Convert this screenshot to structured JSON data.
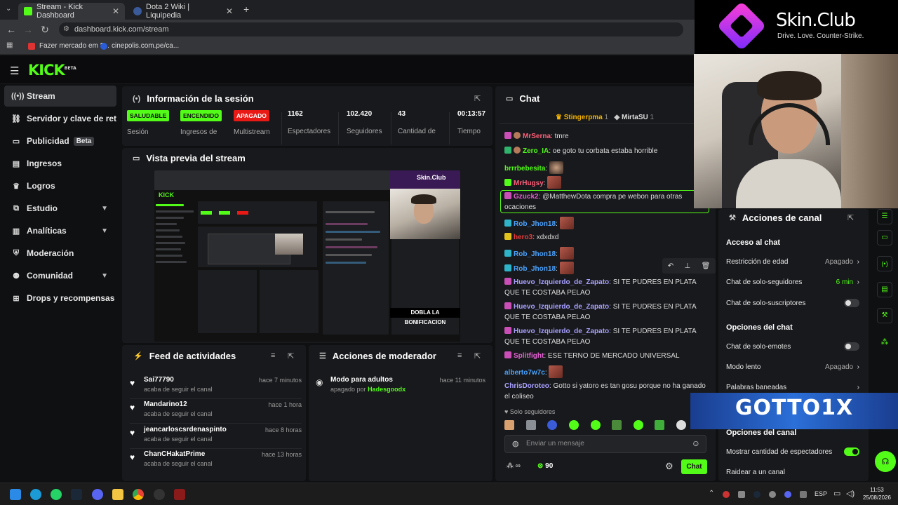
{
  "browser": {
    "tabs": [
      {
        "title": "Stream - Kick Dashboard",
        "active": true
      },
      {
        "title": "Dota 2 Wiki | Liquipedia",
        "active": false
      }
    ],
    "url": "dashboard.kick.com/stream",
    "bookmarks": [
      "Fazer mercado em F...",
      "cinepolis.com.pe/ca..."
    ]
  },
  "brand": {
    "logo": "KICK",
    "logo_sup": "BETA",
    "accent": "#53fc18"
  },
  "sidebar": {
    "items": [
      {
        "label": "Stream",
        "icon": "broadcast-icon",
        "active": true
      },
      {
        "label": "Servidor y clave de retransmisión",
        "icon": "link-icon"
      },
      {
        "label": "Publicidad",
        "icon": "ad-icon",
        "badge": "Beta"
      },
      {
        "label": "Ingresos",
        "icon": "money-icon"
      },
      {
        "label": "Logros",
        "icon": "trophy-icon"
      },
      {
        "label": "Estudio",
        "icon": "studio-icon",
        "expandable": true
      },
      {
        "label": "Analíticas",
        "icon": "chart-icon",
        "expandable": true
      },
      {
        "label": "Moderación",
        "icon": "shield-icon"
      },
      {
        "label": "Comunidad",
        "icon": "people-icon",
        "expandable": true
      },
      {
        "label": "Drops y recompensas",
        "icon": "gift-icon"
      }
    ]
  },
  "session": {
    "title": "Información de la sesión",
    "stats": [
      {
        "pill": "SALUDABLE",
        "label": "Sesión",
        "status": "green"
      },
      {
        "pill": "ENCENDIDO",
        "label": "Ingresos de",
        "status": "green"
      },
      {
        "pill": "APAGADO",
        "label": "Multistream",
        "status": "red"
      },
      {
        "value": "1162",
        "label": "Espectadores"
      },
      {
        "value": "102.420",
        "label": "Seguidores"
      },
      {
        "value": "43",
        "label": "Cantidad de"
      },
      {
        "value": "00:13:57",
        "label": "Tiempo"
      }
    ]
  },
  "preview": {
    "title": "Vista previa del stream",
    "overlay_text": "DOBLA LA BONIFICACION",
    "sponsor": "Skin.Club",
    "sponsor_tag": "Drive. Love. Counter-Strike."
  },
  "feed": {
    "title": "Feed de actividades",
    "items": [
      {
        "name": "Sai77790",
        "sub": "acaba de seguir el canal",
        "time": "hace 7 minutos"
      },
      {
        "name": "Mandarino12",
        "sub": "acaba de seguir el canal",
        "time": "hace 1 hora"
      },
      {
        "name": "jeancarloscsrdenaspinto",
        "sub": "acaba de seguir el canal",
        "time": "hace 8 horas"
      },
      {
        "name": "ChanCHakatPrime",
        "sub": "acaba de seguir el canal",
        "time": "hace 13 horas"
      }
    ]
  },
  "modactions": {
    "title": "Acciones de moderador",
    "items": [
      {
        "title": "Modo para adultos",
        "sub_prefix": "apagado por",
        "sub_user": "Hadesgoodx",
        "time": "hace 11 minutos"
      }
    ]
  },
  "chat": {
    "title": "Chat",
    "pinned": [
      {
        "name": "Stingerpma",
        "count": "1"
      },
      {
        "name": "MirtaSU",
        "count": "1"
      }
    ],
    "messages": [
      {
        "user": "MrSerna",
        "color": "#ff5f7a",
        "text": ": tmre",
        "badge": "#c94fb6"
      },
      {
        "user": "Zero_IA",
        "color": "#53fc18",
        "text": ": oe goto tu corbata estaba horrible",
        "badge": "#2fb36d"
      },
      {
        "user": "brrrbebesita",
        "color": "#53fc18",
        "text": ":",
        "emote": true
      },
      {
        "user": "MrHugsy",
        "color": "#ff5f7a",
        "text": ":",
        "emote": true,
        "badge": "#53fc18"
      },
      {
        "user": "Gzuck2",
        "color": "#e060d0",
        "text": ": @MatthewDota compra pe webon para otras ocaciones",
        "badge": "#c94fb6"
      },
      {
        "user": "Rob_Jhon18",
        "color": "#4aa3ff",
        "text": ":",
        "emote": true,
        "badge": "#2fb3c9"
      },
      {
        "user": "hero3",
        "color": "#e93b3b",
        "text": ": xdxdxd",
        "badge": "#e2c21d"
      },
      {
        "user": "Rob_Jhon18",
        "color": "#4aa3ff",
        "text": ":",
        "emote": true,
        "badge": "#2fb3c9"
      },
      {
        "user": "Rob_Jhon18",
        "color": "#4aa3ff",
        "text": ":",
        "emote": true,
        "badge": "#2fb3c9"
      },
      {
        "user": "Huevo_Izquierdo_de_Zapato",
        "color": "#a8a0ff",
        "text": ": SI TE PUDRES EN PLATA QUE TE COSTABA PELAO",
        "badge": "#c94fb6"
      },
      {
        "user": "Huevo_Izquierdo_de_Zapato",
        "color": "#a8a0ff",
        "text": ": SI TE PUDRES EN PLATA QUE TE COSTABA PELAO",
        "badge": "#c94fb6"
      },
      {
        "user": "Huevo_Izquierdo_de_Zapato",
        "color": "#a8a0ff",
        "text": ": SI TE PUDRES EN PLATA QUE TE COSTABA PELAO",
        "badge": "#c94fb6"
      },
      {
        "user": "Splitfight",
        "color": "#e060d0",
        "text": ": ESE TERNO DE MERCADO UNIVERSAL",
        "badge": "#c94fb6"
      },
      {
        "user": "alberto7w7c",
        "color": "#4aa3ff",
        "text": ":",
        "emote": true
      },
      {
        "user": "ChrisDoroteo",
        "color": "#a8a0ff",
        "text": ": Gotto si yatoro es tan gosu porque no ha ganado el coliseo"
      }
    ],
    "mode_label": "Solo seguidores",
    "input_placeholder": "Enviar un mensaje",
    "send_label": "Chat",
    "points_prefix": "∞",
    "points": "90"
  },
  "channel_actions": {
    "title": "Acciones de canal",
    "section_chat_access": "Acceso al chat",
    "age_restriction": {
      "label": "Restricción de edad",
      "value": "Apagado"
    },
    "followers_only": {
      "label": "Chat de solo-seguidores",
      "value": "6 min"
    },
    "subs_only": {
      "label": "Chat de solo-suscriptores"
    },
    "section_chat_options": "Opciones del chat",
    "emotes_only": {
      "label": "Chat de solo-emotes"
    },
    "slow_mode": {
      "label": "Modo lento",
      "value": "Apagado"
    },
    "banned_words": {
      "label": "Palabras baneadas"
    },
    "section_channel_options": "Opciones del canal",
    "show_viewers": {
      "label": "Mostrar cantidad de espectadores",
      "on": true
    },
    "raid": {
      "label": "Raidear a un canal"
    }
  },
  "overlays": {
    "sponsor": "Skin.Club",
    "sponsor_tag": "Drive. Love. Counter-Strike.",
    "streamer_banner": "GOTTO1X"
  },
  "taskbar": {
    "lang": "ESP",
    "time": "11:53",
    "date": "25/08/2026"
  }
}
